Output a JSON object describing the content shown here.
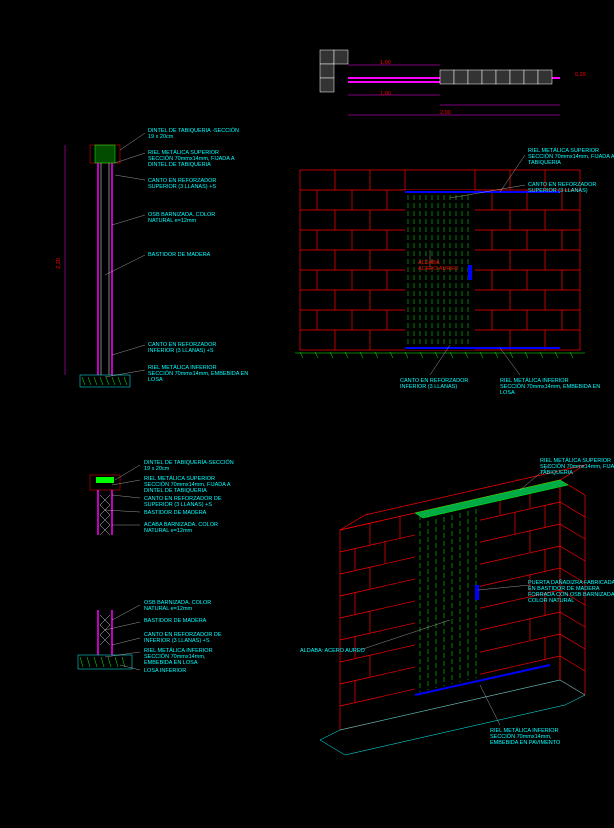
{
  "top_plan": {
    "dims": {
      "w1": "1,00",
      "w2": "1,00",
      "w3": "2,00",
      "h": "0,20"
    }
  },
  "section_a": {
    "height_dim": "2,20",
    "labels": {
      "dintel": "DINTEL DE TABIQUERIA -SECCIÓN\n19 x 20cm",
      "riel_sup": "RIEL METÁLICA SUPERIOR\nSECCIÓN 70mmx14mm, FIJADA A\nDINTEL DE TABIQUERIA",
      "canto_sup": "CANTO EN REFORZADOR\nSUPERIOR (3 LLANAS) +S",
      "osb": "OSB BARNIZADA. COLOR\nNATURAL e=12mm",
      "bastidor": "BASTIDOR DE MADERA",
      "canto_inf": "CANTO EN REFORZADOR\nINFERIOR (3 LLANAS) +S",
      "riel_inf": "RIEL METÁLICA INFERIOR\nSECCIÓN 70mmx14mm, EMBEBIDA EN\nLOSA"
    }
  },
  "elevation": {
    "labels": {
      "riel_sup": "RIEL METÁLICA SUPERIOR\nSECCIÓN 70mmx14mm, FIJADA A\nTABIQUERIA",
      "canto_sup": "CANTO EN REFORZADOR\nSUPERIOR (3 LLANAS)",
      "aldaba": "ALDABA\nACERO AUREO",
      "canto_inf": "CANTO EN REFORZADOR\nINFERIOR (3 LLANAS)",
      "riel_inf": "RIEL METÁLICA INFERIOR\nSECCIÓN 70mmx14mm, EMBEBIDA EN\nLOSA"
    }
  },
  "section_b": {
    "labels": {
      "dintel": "DINTEL DE TABIQUERÍA-SECCIÓN\n19 x 20cm",
      "riel": "RIEL METÁLICA SUPERIOR\nSECCIÓN 70mmx14mm, FIJADA A\nDINTEL DE TABIQUERIA",
      "canto": "CANTO EN REFORZADOR DE\nSUPERIOR (3 LLANAS) +S",
      "bastidor": "BASTIDOR DE MADERA",
      "osb": "ACABA BARNIZADA. COLOR\nNATURAL e=12mm"
    }
  },
  "section_c": {
    "labels": {
      "osb": "OSB BARNIZADA. COLOR\nNATURAL e=12mm",
      "bastidor": "BASTIDOR DE MADERA",
      "canto": "CANTO EN REFORZADOR DE\nINFERIOR (3 LLANAS) +S",
      "riel": "RIEL METÁLICA INFERIOR\nSECCIÓN 70mmx14mm,\nEMBEBIDA EN LOSA",
      "losa": "LOSA INFERIOR"
    }
  },
  "iso": {
    "labels": {
      "riel_sup": "RIEL METÁLICA SUPERIOR\nSECCIÓN 70mmx14mm, FIJADA A\nTABIQUERIA",
      "puerta": "PUERTA DAÑADIZRA FABRICADA\nEN BASTIDOR DE MADERA\nFORRADA CON OSB BARNIZADA\nCOLOR NATURAL",
      "aldaba": "ALDABA: ACERO AUREO",
      "riel_inf": "RIEL METÁLICA INFERIOR\nSECCIÓN 70mmx14mm,\nEMBEBIDA EN PAVIMENTO"
    }
  }
}
